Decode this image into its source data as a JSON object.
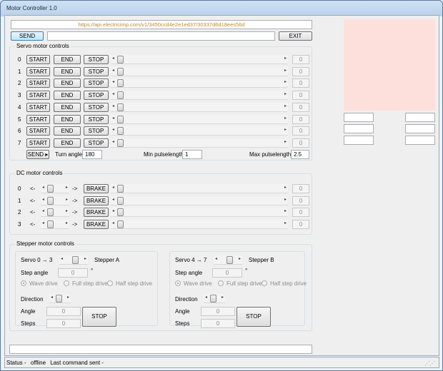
{
  "window": {
    "title": "Motor Controller 1.0"
  },
  "top": {
    "url": "https://api.electricimp.com/v1/3450ccd4e2e1ed37/30337d6d18ees56d",
    "send_label": "SEND",
    "command_value": "",
    "exit_label": "EXIT"
  },
  "servo": {
    "group_title": "Servo motor controls",
    "start_label": "START",
    "end_label": "END",
    "stop_label": "STOP",
    "rows": [
      {
        "index": "0",
        "value": "0",
        "level": 0
      },
      {
        "index": "1",
        "value": "0",
        "level": 0
      },
      {
        "index": "2",
        "value": "0",
        "level": 0
      },
      {
        "index": "3",
        "value": "0",
        "level": 0
      },
      {
        "index": "4",
        "value": "0",
        "level": 0
      },
      {
        "index": "5",
        "value": "0",
        "level": 0
      },
      {
        "index": "6",
        "value": "0",
        "level": 0
      },
      {
        "index": "7",
        "value": "0",
        "level": 0
      }
    ],
    "send_label": "SEND ▸",
    "turn_angle_label": "Turn angle",
    "turn_angle_value": "180",
    "min_pulse_label": "Min pulselength",
    "min_pulse_value": "1",
    "max_pulse_label": "Max pulselength",
    "max_pulse_value": "2.5"
  },
  "dc": {
    "group_title": "DC motor controls",
    "left_arrow": "<-",
    "right_arrow": "->",
    "brake_label": "BRAKE",
    "rows": [
      {
        "index": "0",
        "value": "0",
        "level": 0
      },
      {
        "index": "1",
        "value": "0",
        "level": 0
      },
      {
        "index": "2",
        "value": "0",
        "level": 0
      },
      {
        "index": "3",
        "value": "0",
        "level": 0
      }
    ]
  },
  "stepper": {
    "group_title": "Stepper motor controls",
    "panels": [
      {
        "servo_label": "Servo 0 → 3",
        "stepper_label": "Stepper A",
        "step_angle_label": "Step angle",
        "step_angle_value": "0",
        "degree": "°",
        "wave_drive": "Wave drive",
        "full_step_drive": "Full step drive",
        "half_step_drive": "Half step drive",
        "direction_label": "Direction",
        "angle_label": "Angle",
        "angle_value": "0",
        "steps_label": "Steps",
        "steps_value": "0",
        "stop_label": "STOP"
      },
      {
        "servo_label": "Servo 4 → 7",
        "stepper_label": "Stepper B",
        "step_angle_label": "Step angle",
        "step_angle_value": "0",
        "degree": "°",
        "wave_drive": "Wave drive",
        "full_step_drive": "Full step drive",
        "half_step_drive": "Half step drive",
        "direction_label": "Direction",
        "angle_label": "Angle",
        "angle_value": "0",
        "steps_label": "Steps",
        "steps_value": "0",
        "stop_label": "STOP"
      }
    ]
  },
  "side_fields": [
    "",
    "",
    "",
    "",
    "",
    ""
  ],
  "bottom_input": "",
  "status": {
    "status_label": "Status -",
    "status_value": "offline",
    "last_command_label": "Last command sent -"
  },
  "colors": {
    "preview": "#fde0dc",
    "url_text": "#c08a32"
  }
}
